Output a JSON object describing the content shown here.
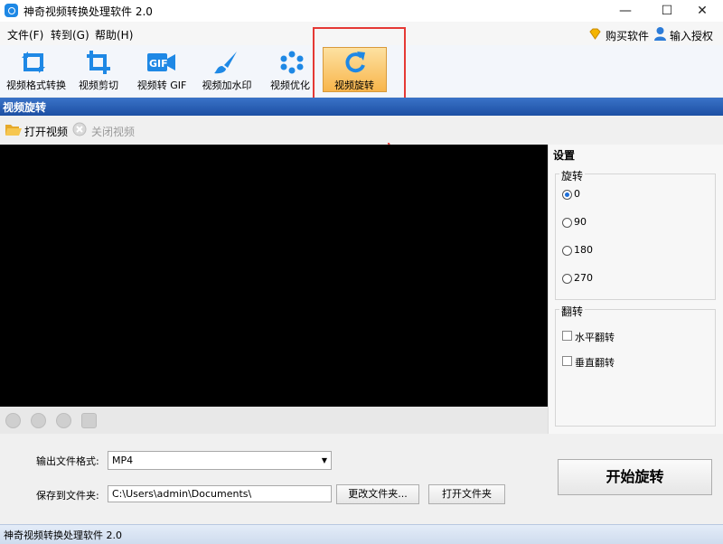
{
  "window": {
    "title": "神奇视频转换处理软件 2.0",
    "controls": {
      "minimize": "—",
      "maximize": "☐",
      "close": "✕"
    }
  },
  "menu": {
    "items": [
      "文件(F)",
      "转到(G)",
      "帮助(H)"
    ],
    "buy_label": "购买软件",
    "license_label": "输入授权码"
  },
  "toolbar": {
    "tools": [
      {
        "label": "视频格式转换",
        "icon": "convert-icon"
      },
      {
        "label": "视频剪切",
        "icon": "crop-icon"
      },
      {
        "label": "视频转 GIF",
        "icon": "gif-icon"
      },
      {
        "label": "视频加水印",
        "icon": "brush-icon"
      },
      {
        "label": "视频优化",
        "icon": "optimize-icon"
      },
      {
        "label": "视频旋转",
        "icon": "rotate-icon",
        "active": true
      }
    ],
    "gif_text": "GIF"
  },
  "section": {
    "title": "视频旋转"
  },
  "subtoolbar": {
    "open_label": "打开视频",
    "close_label": "关闭视频"
  },
  "settings": {
    "title": "设置",
    "rotate_group": "旋转",
    "rotate_options": [
      "0",
      "90",
      "180",
      "270"
    ],
    "rotate_selected": "0",
    "flip_group": "翻转",
    "flip_options": [
      "水平翻转",
      "垂直翻转"
    ]
  },
  "output": {
    "format_label": "输出文件格式:",
    "format_value": "MP4",
    "folder_label": "保存到文件夹:",
    "folder_value": "C:\\Users\\admin\\Documents\\",
    "change_folder_label": "更改文件夹...",
    "open_folder_label": "打开文件夹",
    "start_label": "开始旋转"
  },
  "status": {
    "text": "神奇视频转换处理软件 2.0"
  },
  "colors": {
    "accent": "#1d4fa3",
    "highlight": "#e53935",
    "active_tool": "#f8b54b"
  }
}
